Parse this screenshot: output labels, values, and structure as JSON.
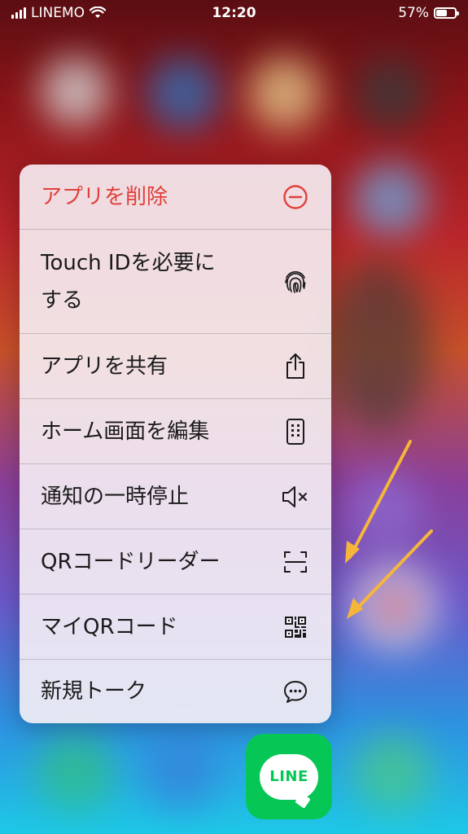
{
  "status_bar": {
    "carrier": "LINEMO",
    "time": "12:20",
    "battery_percent": "57%",
    "battery_level": 0.57
  },
  "context_menu": {
    "items": [
      {
        "label": "アプリを削除",
        "icon": "minus-circle-icon",
        "destructive": true
      },
      {
        "label": "Touch IDを必要にする",
        "label_line1": "Touch IDを必要に",
        "label_line2": "する",
        "icon": "fingerprint-icon"
      },
      {
        "label": "アプリを共有",
        "icon": "share-icon"
      },
      {
        "label": "ホーム画面を編集",
        "icon": "phone-edit-icon"
      },
      {
        "label": "通知の一時停止",
        "icon": "speaker-mute-icon"
      },
      {
        "label": "QRコードリーダー",
        "icon": "qr-scan-icon"
      },
      {
        "label": "マイQRコード",
        "icon": "qr-code-icon"
      },
      {
        "label": "新規トーク",
        "icon": "chat-bubble-icon"
      }
    ]
  },
  "dock": {
    "app_label": "LINE",
    "brand_color": "#06c755"
  },
  "colors": {
    "destructive": "#e0403a",
    "annotation_arrow": "#f5b63a"
  }
}
